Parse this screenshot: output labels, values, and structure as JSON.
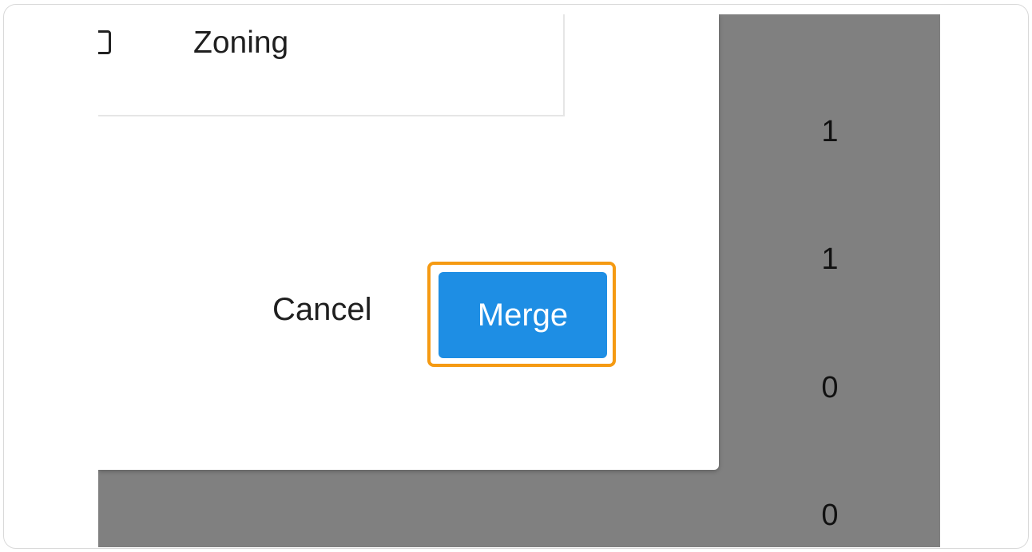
{
  "column_list": {
    "items": [
      {
        "label": "Zoning",
        "checked": false
      }
    ]
  },
  "dialog": {
    "cancel_label": "Cancel",
    "merge_label": "Merge"
  },
  "background_table": {
    "counts": [
      "1",
      "1",
      "0",
      "0"
    ]
  },
  "colors": {
    "primary_button": "#1e8ee4",
    "highlight": "#f59a12",
    "overlay": "#808080"
  }
}
